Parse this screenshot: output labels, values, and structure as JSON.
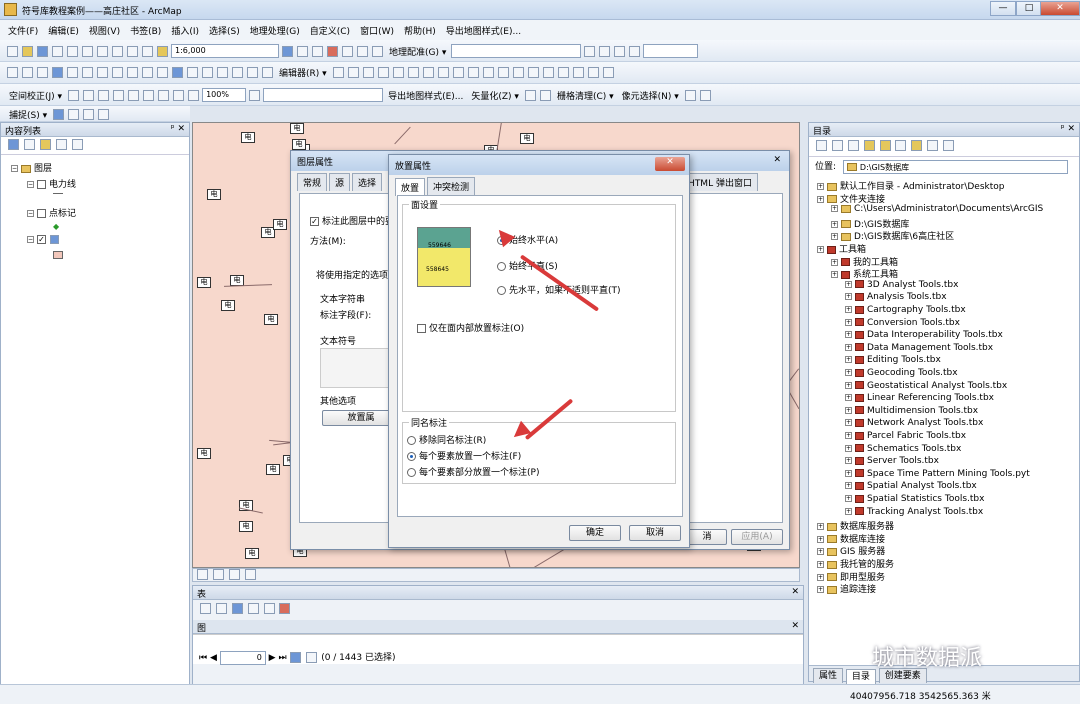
{
  "window": {
    "title": "符号库教程案例——高庄社区 - ArcMap",
    "min": "—",
    "max": "□",
    "close": "✕"
  },
  "menu": [
    "文件(F)",
    "编辑(E)",
    "视图(V)",
    "书签(B)",
    "插入(I)",
    "选择(S)",
    "地理处理(G)",
    "自定义(C)",
    "窗口(W)",
    "帮助(H)",
    "导出地图样式(E)..."
  ],
  "toolbar1": {
    "scale": "1:6,000",
    "georef": "地理配准(G) ▾"
  },
  "toolbar2": {
    "editor": "编辑器(R) ▾"
  },
  "toolbar3": {
    "spatial_adjust": "空间校正(J) ▾",
    "zoom": "100%",
    "export": "导出地图样式(E)...",
    "vectorize": "矢量化(Z) ▾",
    "raster_clean": "栅格清理(C) ▾",
    "pixel_select": "像元选择(N) ▾"
  },
  "toolbar4": {
    "snap": "捕捉(S) ▾"
  },
  "toc": {
    "title": "内容列表",
    "pin": "ᵖ ✕",
    "items": [
      "图层",
      "电力线",
      "点标记"
    ]
  },
  "layer_props": {
    "title": "图层属性",
    "tabs": [
      "常规",
      "源",
      "选择"
    ],
    "tab_right": "HTML 弹出窗口",
    "label_check": "标注此图层中的要",
    "method": "方法(M):",
    "use_text": "将使用指定的选项",
    "text_string": "文本字符串",
    "label_field": "标注字段(F):",
    "text_symbol": "文本符号",
    "other_options": "其他选项",
    "placement_btn": "放置属",
    "cancel": "消",
    "apply": "应用(A)"
  },
  "placement": {
    "title": "放置属性",
    "tabs": [
      "放置",
      "冲突检测"
    ],
    "group_polygon": "面设置",
    "options": [
      "始终水平(A)",
      "始终平直(S)",
      "先水平，如果不适则平直(T)"
    ],
    "inside_only": "仅在面内部放置标注(O)",
    "preview_labels": [
      "559646",
      "558645"
    ],
    "group_duplicate": "同名标注",
    "dup_options": [
      "移除同名标注(R)",
      "每个要素放置一个标注(F)",
      "每个要素部分放置一个标注(P)"
    ],
    "ok": "确定",
    "cancel": "取消"
  },
  "table": {
    "title": "表",
    "title2": "图",
    "record": "0",
    "selection": "(0 / 1443 已选择)"
  },
  "catalog": {
    "title": "目录",
    "location_label": "位置:",
    "location": "D:\\GIS数据库",
    "items": [
      {
        "t": "默认工作目录 - Administrator\\Desktop",
        "lvl": 0,
        "ic": "fld"
      },
      {
        "t": "文件夹连接",
        "lvl": 0,
        "ic": "fld"
      },
      {
        "t": "C:\\Users\\Administrator\\Documents\\ArcGIS",
        "lvl": 1,
        "ic": "fld"
      },
      {
        "t": "D:\\GIS数据库",
        "lvl": 1,
        "ic": "fld"
      },
      {
        "t": "D:\\GIS数据库\\6高庄社区",
        "lvl": 1,
        "ic": "fld"
      },
      {
        "t": "工具箱",
        "lvl": 0,
        "ic": "tbx"
      },
      {
        "t": "我的工具箱",
        "lvl": 1,
        "ic": "tbx"
      },
      {
        "t": "系统工具箱",
        "lvl": 1,
        "ic": "tbx"
      },
      {
        "t": "3D Analyst Tools.tbx",
        "lvl": 2,
        "ic": "tbx"
      },
      {
        "t": "Analysis Tools.tbx",
        "lvl": 2,
        "ic": "tbx"
      },
      {
        "t": "Cartography Tools.tbx",
        "lvl": 2,
        "ic": "tbx"
      },
      {
        "t": "Conversion Tools.tbx",
        "lvl": 2,
        "ic": "tbx"
      },
      {
        "t": "Data Interoperability Tools.tbx",
        "lvl": 2,
        "ic": "tbx"
      },
      {
        "t": "Data Management Tools.tbx",
        "lvl": 2,
        "ic": "tbx"
      },
      {
        "t": "Editing Tools.tbx",
        "lvl": 2,
        "ic": "tbx"
      },
      {
        "t": "Geocoding Tools.tbx",
        "lvl": 2,
        "ic": "tbx"
      },
      {
        "t": "Geostatistical Analyst Tools.tbx",
        "lvl": 2,
        "ic": "tbx"
      },
      {
        "t": "Linear Referencing Tools.tbx",
        "lvl": 2,
        "ic": "tbx"
      },
      {
        "t": "Multidimension Tools.tbx",
        "lvl": 2,
        "ic": "tbx"
      },
      {
        "t": "Network Analyst Tools.tbx",
        "lvl": 2,
        "ic": "tbx"
      },
      {
        "t": "Parcel Fabric Tools.tbx",
        "lvl": 2,
        "ic": "tbx"
      },
      {
        "t": "Schematics Tools.tbx",
        "lvl": 2,
        "ic": "tbx"
      },
      {
        "t": "Server Tools.tbx",
        "lvl": 2,
        "ic": "tbx"
      },
      {
        "t": "Space Time Pattern Mining Tools.pyt",
        "lvl": 2,
        "ic": "tbx"
      },
      {
        "t": "Spatial Analyst Tools.tbx",
        "lvl": 2,
        "ic": "tbx"
      },
      {
        "t": "Spatial Statistics Tools.tbx",
        "lvl": 2,
        "ic": "tbx"
      },
      {
        "t": "Tracking Analyst Tools.tbx",
        "lvl": 2,
        "ic": "tbx"
      },
      {
        "t": "数据库服务器",
        "lvl": 0,
        "ic": "fld"
      },
      {
        "t": "数据库连接",
        "lvl": 0,
        "ic": "fld"
      },
      {
        "t": "GIS 服务器",
        "lvl": 0,
        "ic": "fld"
      },
      {
        "t": "我托管的服务",
        "lvl": 0,
        "ic": "fld"
      },
      {
        "t": "即用型服务",
        "lvl": 0,
        "ic": "fld"
      },
      {
        "t": "追踪连接",
        "lvl": 0,
        "ic": "fld"
      }
    ],
    "bottom_tabs": [
      "属性",
      "目录",
      "创建要素"
    ]
  },
  "status": {
    "coords": "40407956.718  3542565.363 米"
  },
  "watermark": "城市数据派",
  "map_label": "电"
}
